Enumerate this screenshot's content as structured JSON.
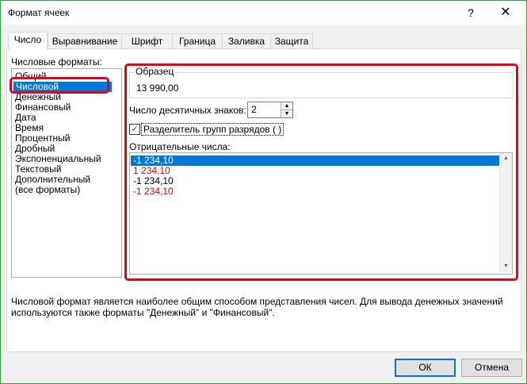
{
  "window": {
    "title": "Формат ячеек",
    "help_label": "?",
    "close_label": "✕"
  },
  "tabs": [
    {
      "label": "Число",
      "active": true
    },
    {
      "label": "Выравнивание"
    },
    {
      "label": "Шрифт"
    },
    {
      "label": "Граница"
    },
    {
      "label": "Заливка"
    },
    {
      "label": "Защита"
    }
  ],
  "formats": {
    "label": "Числовые форматы:",
    "items": [
      "Общий",
      "Числовой",
      "Денежный",
      "Финансовый",
      "Дата",
      "Время",
      "Процентный",
      "Дробный",
      "Экспоненциальный",
      "Текстовый",
      "Дополнительный",
      "(все форматы)"
    ],
    "selected": "Числовой"
  },
  "sample": {
    "legend": "Образец",
    "value": "13 990,00"
  },
  "decimals": {
    "label": "Число десятичных знаков:",
    "value": "2"
  },
  "separator": {
    "label": "Разделитель групп разрядов ( )",
    "checked": true,
    "check_glyph": "✓"
  },
  "negative": {
    "label": "Отрицательные числа:",
    "items": [
      {
        "text": "-1 234,10",
        "color": "#000000",
        "selected": true
      },
      {
        "text": "1 234,10",
        "color": "#e00000"
      },
      {
        "text": "-1 234,10",
        "color": "#000000"
      },
      {
        "text": "-1 234,10",
        "color": "#e00000"
      }
    ]
  },
  "description": "Числовой формат является наиболее общим способом представления чисел. Для вывода денежных значений используются также форматы \"Денежный\" и \"Финансовый\".",
  "buttons": {
    "ok": "ОК",
    "cancel": "Отмена"
  },
  "colors": {
    "highlight": "#e6001e",
    "selection": "#0078d7",
    "negative_red": "#e00000"
  }
}
